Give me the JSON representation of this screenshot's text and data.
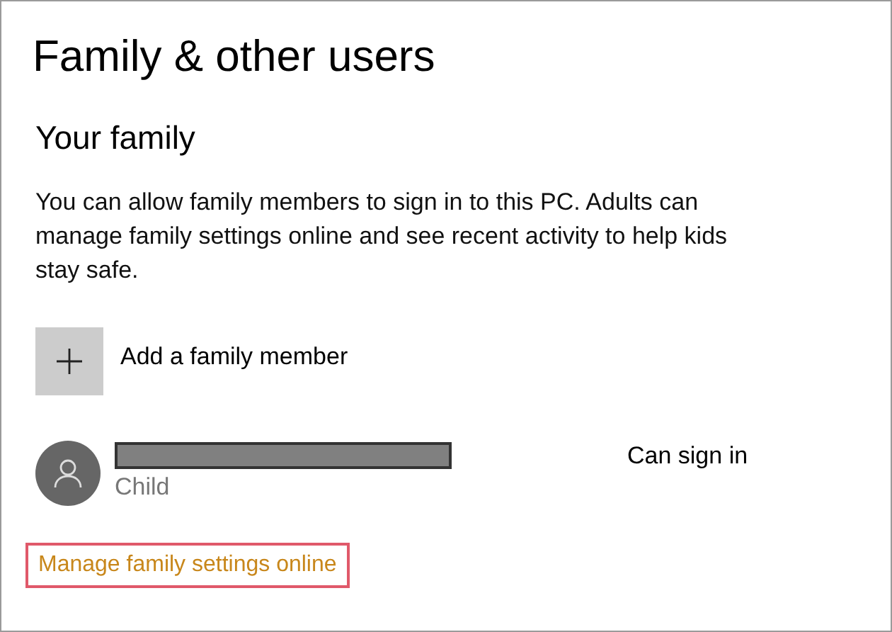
{
  "title": "Family & other users",
  "section": {
    "heading": "Your family",
    "description": "You can allow family members to sign in to this PC. Adults can manage family settings online and see recent activity to help kids stay safe."
  },
  "add_member": {
    "label": "Add a family member"
  },
  "members": [
    {
      "name_redacted": true,
      "role": "Child",
      "status": "Can sign in"
    }
  ],
  "link": {
    "label": "Manage family settings online",
    "highlighted": true
  }
}
